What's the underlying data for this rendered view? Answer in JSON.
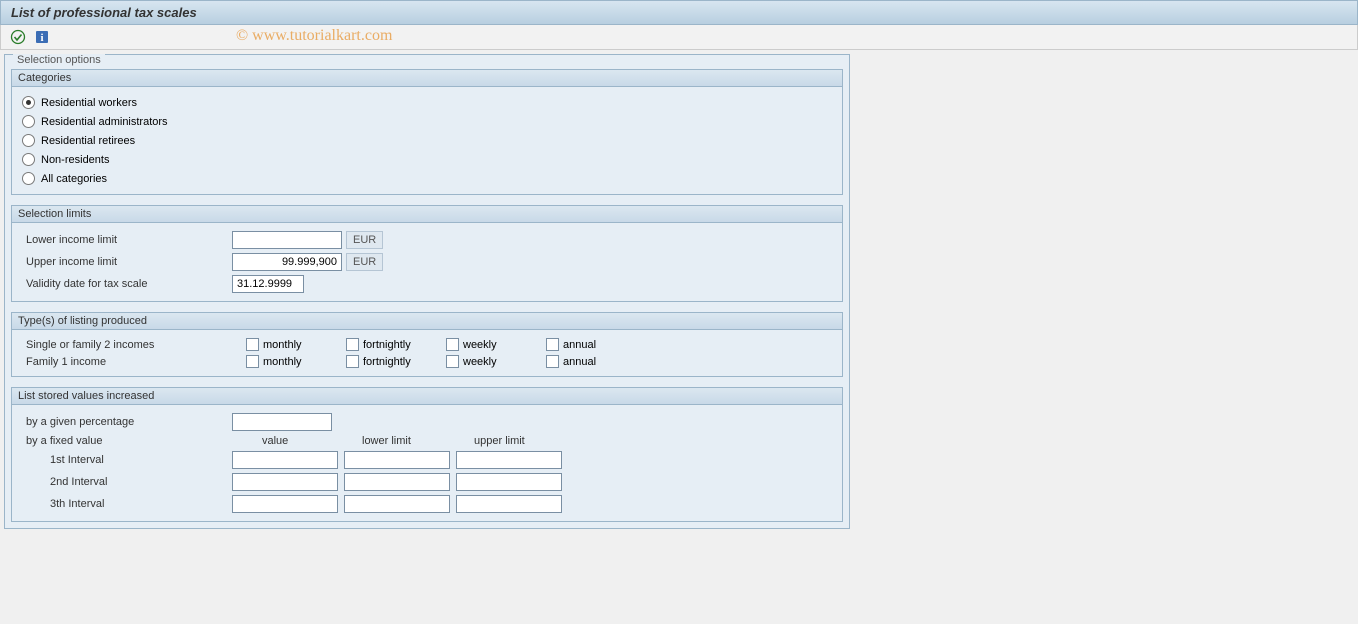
{
  "title": "List of professional tax scales",
  "watermark": "© www.tutorialkart.com",
  "outerGroup": "Selection options",
  "groups": {
    "categories": {
      "title": "Categories",
      "options": [
        {
          "label": "Residential workers",
          "selected": true
        },
        {
          "label": "Residential administrators",
          "selected": false
        },
        {
          "label": "Residential retirees",
          "selected": false
        },
        {
          "label": "Non-residents",
          "selected": false
        },
        {
          "label": "All categories",
          "selected": false
        }
      ]
    },
    "limits": {
      "title": "Selection limits",
      "lowerLabel": "Lower income limit",
      "lowerValue": "",
      "lowerCurrency": "EUR",
      "upperLabel": "Upper income limit",
      "upperValue": "99.999,900",
      "upperCurrency": "EUR",
      "validityLabel": "Validity date for tax scale",
      "validityValue": "31.12.9999"
    },
    "listingTypes": {
      "title": "Type(s) of listing produced",
      "rows": [
        {
          "label": "Single or family 2 incomes"
        },
        {
          "label": "Family 1 income"
        }
      ],
      "cols": [
        "monthly",
        "fortnightly",
        "weekly",
        "annual"
      ]
    },
    "increased": {
      "title": "List stored values increased",
      "percentLabel": "by a given percentage",
      "percentValue": "",
      "fixedLabel": "by a fixed value",
      "colHeaders": {
        "value": "value",
        "lower": "lower limit",
        "upper": "upper limit"
      },
      "intervals": [
        {
          "label": "1st Interval",
          "value": "",
          "lower": "",
          "upper": ""
        },
        {
          "label": "2nd Interval",
          "value": "",
          "lower": "",
          "upper": ""
        },
        {
          "label": "3th Interval",
          "value": "",
          "lower": "",
          "upper": ""
        }
      ]
    }
  }
}
